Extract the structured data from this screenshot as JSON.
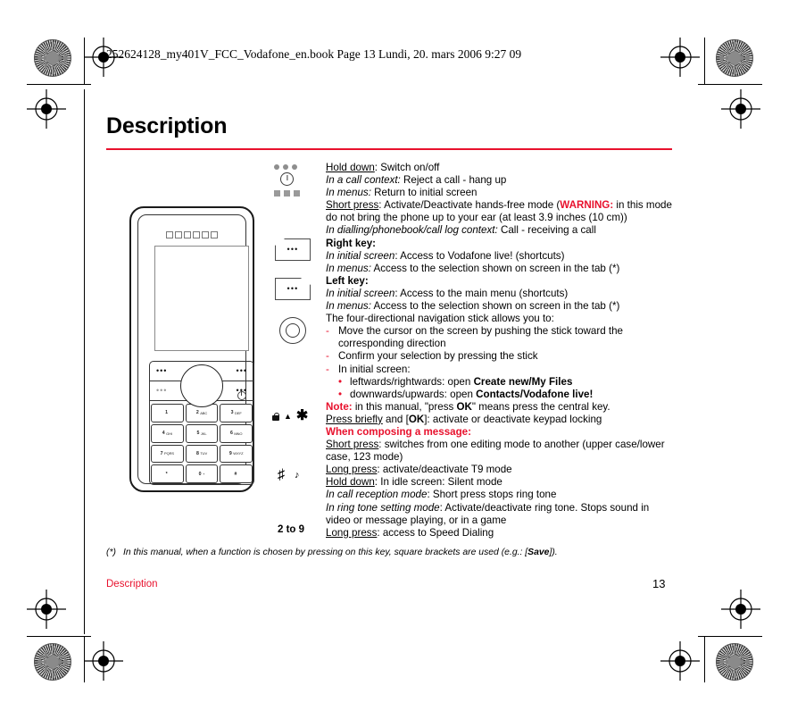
{
  "print": {
    "filename_line": "252624128_my401V_FCC_Vodafone_en.book  Page 13  Lundi, 20. mars 2006  9:27 09",
    "accent_red": "#e8112d"
  },
  "page": {
    "title": "Description",
    "footer_chapter": "Description",
    "page_number": "13",
    "footnote_mark": "(*)",
    "footnote_text_1": "In this manual, when a function is chosen by pressing on this key, square brackets are used (e.g.: [",
    "footnote_bold": "Save",
    "footnote_text_2": "])."
  },
  "phone": {
    "speaker_holes": 6,
    "left_softkey_dots": "•••",
    "right_softkey_dots": "•••",
    "keys": [
      {
        "num": "1",
        "abc": ""
      },
      {
        "num": "2",
        "abc": "ABC"
      },
      {
        "num": "3",
        "abc": "DEF"
      },
      {
        "num": "4",
        "abc": "GHI"
      },
      {
        "num": "5",
        "abc": "JKL"
      },
      {
        "num": "6",
        "abc": "MNO"
      },
      {
        "num": "7",
        "abc": "PQRS"
      },
      {
        "num": "8",
        "abc": "TUV"
      },
      {
        "num": "9",
        "abc": "WXYZ"
      },
      {
        "num": "*",
        "abc": ""
      },
      {
        "num": "0",
        "abc": "+"
      },
      {
        "num": "#",
        "abc": ""
      }
    ]
  },
  "entries": [
    {
      "id": "power-key",
      "icons": [
        "three-dots",
        "power-symbol",
        "three-squares"
      ],
      "lines": [
        {
          "lead": "Hold down",
          "lead_style": "underline",
          "rest": ": Switch on/off"
        },
        {
          "lead": "In a call context:",
          "lead_style": "italic",
          "rest": " Reject a call - hang up"
        },
        {
          "lead": "In menus:",
          "lead_style": "italic",
          "rest": " Return to initial screen"
        }
      ]
    },
    {
      "id": "call-key",
      "lines": [
        {
          "lead": "Short press",
          "lead_style": "underline",
          "rest": ": Activate/Deactivate hands-free mode (",
          "warning": "WARNING:",
          "after_warning": " in this mode do not bring the phone up to your ear (at least 3.9 inches (10 cm))"
        },
        {
          "lead": "In dialling/phonebook/call log context:",
          "lead_style": "italic",
          "rest": " Call - receiving a call"
        }
      ]
    },
    {
      "id": "right-key",
      "title": "Right key:",
      "lines": [
        {
          "lead": "In initial screen",
          "lead_style": "italic",
          "rest": ": Access to Vodafone live! (shortcuts)"
        },
        {
          "lead": "In menus:",
          "lead_style": "italic",
          "rest": " Access to the selection shown on screen in the tab (*)"
        }
      ]
    },
    {
      "id": "left-key",
      "title": "Left key:",
      "lines": [
        {
          "lead": "In initial screen",
          "lead_style": "italic",
          "rest": ": Access to the main menu (shortcuts)"
        },
        {
          "lead": "In menus:",
          "lead_style": "italic",
          "rest": " Access to the selection shown on screen in the tab (*)"
        }
      ]
    },
    {
      "id": "navigation-stick",
      "intro": "The four-directional navigation stick allows you to:",
      "dashes": [
        "Move the cursor on the screen by pushing the stick toward the corresponding direction",
        "Confirm your selection by pressing the stick",
        "In initial screen:"
      ],
      "bullets": [
        {
          "pre": "leftwards/rightwards: open ",
          "bold": "Create new/My Files",
          "post": ""
        },
        {
          "pre": "downwards/upwards: open ",
          "bold": "Contacts/Vodafone live!",
          "post": ""
        }
      ],
      "note_label": "Note:",
      "note_pre": " in this manual, \"press ",
      "note_bold": "OK",
      "note_post": "\" means press the central key."
    },
    {
      "id": "star-key",
      "icons": [
        "lock-icon",
        "up-arrow",
        "asterisk-key"
      ],
      "lines": [
        {
          "lead": "Press briefly",
          "lead_style": "underline",
          "rest": " and [",
          "bold_mid": "OK",
          "rest2": "]: activate or deactivate keypad locking"
        }
      ],
      "subtitle": "When composing a message:",
      "more_lines": [
        {
          "lead": "Short press",
          "lead_style": "underline",
          "rest": ": switches from one editing mode to another (upper case/lower case,  123 mode)"
        },
        {
          "lead": "Long press",
          "lead_style": "underline",
          "rest": ": activate/deactivate T9 mode"
        }
      ]
    },
    {
      "id": "hash-key",
      "icons": [
        "hash-key",
        "music-note"
      ],
      "lines": [
        {
          "lead": "Hold down",
          "lead_style": "underline",
          "rest": ": In idle screen: Silent mode"
        },
        {
          "lead": "In call reception mode",
          "lead_style": "italic",
          "rest": ": Short press stops ring tone"
        },
        {
          "lead": "In ring tone setting mode",
          "lead_style": "italic",
          "rest": ": Activate/deactivate ring tone. Stops sound in video or message playing, or in a game"
        }
      ]
    },
    {
      "id": "speed-dial",
      "icon_label": "2 to 9",
      "lines": [
        {
          "lead": "Long press",
          "lead_style": "underline",
          "rest": ": access to Speed Dialing"
        }
      ]
    }
  ]
}
